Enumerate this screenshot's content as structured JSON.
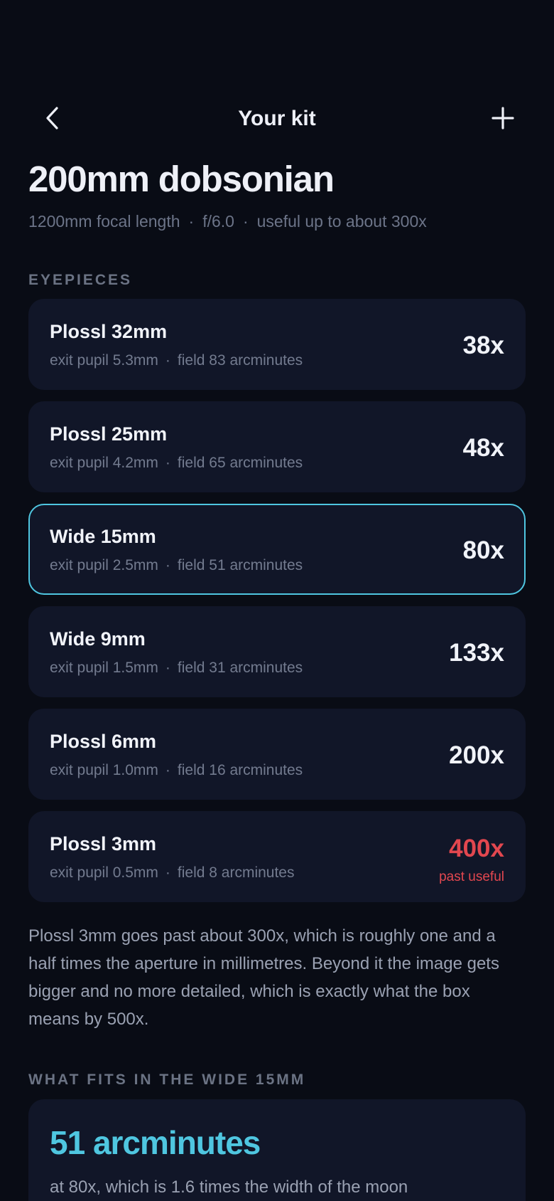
{
  "header": {
    "title": "Your kit",
    "back_icon": "chevron-left-icon",
    "add_icon": "plus-icon"
  },
  "scope": {
    "name": "200mm dobsonian",
    "focal_length": "1200mm focal length",
    "ratio": "f/6.0",
    "useful": "useful up to about 300x"
  },
  "eyepieces_heading": "EYEPIECES",
  "eyepieces": [
    {
      "name": "Plossl 32mm",
      "exit_pupil": "exit pupil 5.3mm",
      "field": "field 83 arcminutes",
      "mag": "38x",
      "selected": false
    },
    {
      "name": "Plossl 25mm",
      "exit_pupil": "exit pupil 4.2mm",
      "field": "field 65 arcminutes",
      "mag": "48x",
      "selected": false
    },
    {
      "name": "Wide 15mm",
      "exit_pupil": "exit pupil 2.5mm",
      "field": "field 51 arcminutes",
      "mag": "80x",
      "selected": true
    },
    {
      "name": "Wide 9mm",
      "exit_pupil": "exit pupil 1.5mm",
      "field": "field 31 arcminutes",
      "mag": "133x",
      "selected": false
    },
    {
      "name": "Plossl 6mm",
      "exit_pupil": "exit pupil 1.0mm",
      "field": "field 16 arcminutes",
      "mag": "200x",
      "selected": false
    },
    {
      "name": "Plossl 3mm",
      "exit_pupil": "exit pupil 0.5mm",
      "field": "field 8 arcminutes",
      "mag": "400x",
      "selected": false,
      "warning": "past useful"
    }
  ],
  "note": "Plossl 3mm goes past about 300x, which is roughly one and a half times the aperture in millimetres. Beyond it the image gets bigger and no more detailed, which is exactly what the box means by 500x.",
  "fit_heading": "WHAT FITS IN THE WIDE 15MM",
  "fit": {
    "value": "51 arcminutes",
    "description": "at 80x, which is 1.6 times the width of the moon"
  },
  "colors": {
    "accent": "#4fc6e0",
    "warning": "#e2474f",
    "background": "#090c15",
    "card": "#111628"
  }
}
